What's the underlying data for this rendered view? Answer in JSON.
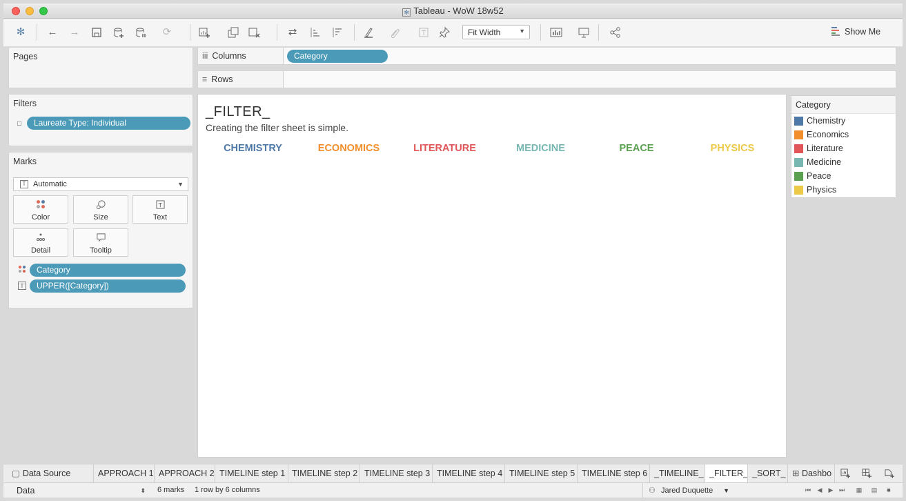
{
  "window": {
    "title": "Tableau - WoW 18w52"
  },
  "toolbar": {
    "fit_label": "Fit Width",
    "show_me_label": "Show Me",
    "icons": [
      "tableau-logo-icon",
      "undo-icon",
      "redo-icon",
      "save-icon",
      "new-data-source-icon",
      "pause-updates-icon",
      "refresh-icon",
      "new-worksheet-icon",
      "duplicate-sheet-icon",
      "clear-sheet-icon",
      "swap-icon",
      "sort-ascending-icon",
      "sort-descending-icon",
      "highlight-icon",
      "group-icon",
      "labels-icon",
      "pin-icon",
      "chart-type-icon",
      "presentation-icon",
      "share-icon"
    ]
  },
  "pages": {
    "title": "Pages"
  },
  "filters": {
    "title": "Filters",
    "pill": "Laureate Type: Individual"
  },
  "marks": {
    "title": "Marks",
    "type": "Automatic",
    "buttons": {
      "color": "Color",
      "size": "Size",
      "text": "Text",
      "detail": "Detail",
      "tooltip": "Tooltip"
    },
    "fields": [
      "Category",
      "UPPER([Category])"
    ]
  },
  "columns": {
    "label": "Columns",
    "pill": "Category"
  },
  "rows": {
    "label": "Rows"
  },
  "viz": {
    "title": "_FILTER_",
    "subtitle": "Creating the filter sheet is simple.",
    "categories": [
      {
        "label": "CHEMISTRY",
        "color": "#4e79a7"
      },
      {
        "label": "ECONOMICS",
        "color": "#f28e2b"
      },
      {
        "label": "LITERATURE",
        "color": "#e15759"
      },
      {
        "label": "MEDICINE",
        "color": "#76b7b2"
      },
      {
        "label": "PEACE",
        "color": "#59a14f"
      },
      {
        "label": "PHYSICS",
        "color": "#edc948"
      }
    ]
  },
  "legend": {
    "title": "Category",
    "items": [
      {
        "label": "Chemistry",
        "color": "#4e79a7"
      },
      {
        "label": "Economics",
        "color": "#f28e2b"
      },
      {
        "label": "Literature",
        "color": "#e15759"
      },
      {
        "label": "Medicine",
        "color": "#76b7b2"
      },
      {
        "label": "Peace",
        "color": "#59a14f"
      },
      {
        "label": "Physics",
        "color": "#edc948"
      }
    ]
  },
  "tabs": {
    "data_source": "Data Source",
    "sheets": [
      "APPROACH 1",
      "APPROACH 2",
      "TIMELINE step 1",
      "TIMELINE step 2",
      "TIMELINE step 3",
      "TIMELINE step 4",
      "TIMELINE step 5",
      "TIMELINE step 6",
      "_TIMELINE_",
      "_FILTER_",
      "_SORT_",
      "Dashbo"
    ]
  },
  "status": {
    "data_select": "Data",
    "marks_count": "6 marks",
    "dimensions": "1 row by 6 columns",
    "user": "Jared Duquette"
  }
}
